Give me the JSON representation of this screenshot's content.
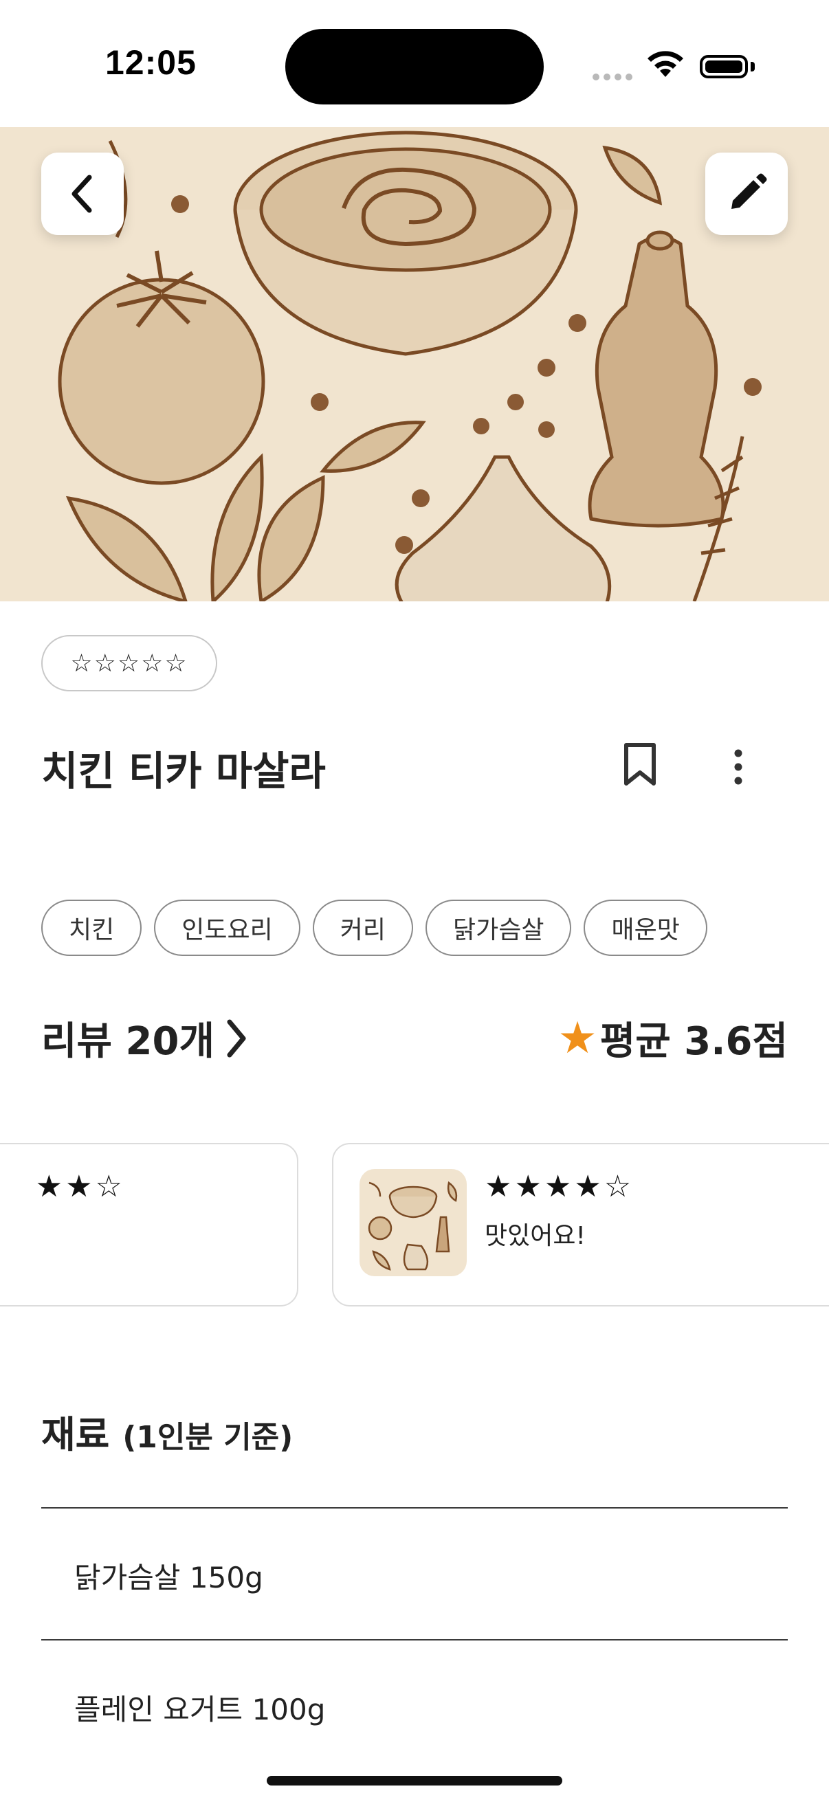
{
  "status_bar": {
    "time": "12:05"
  },
  "recipe": {
    "rating_stars": "☆☆☆☆☆",
    "title": "치킨 티카 마살라",
    "tags": [
      "치킨",
      "인도요리",
      "커리",
      "닭가슴살",
      "매운맛"
    ]
  },
  "reviews": {
    "count_label": "리뷰 20개",
    "average_label": "평균 3.6점",
    "cards": [
      {
        "stars": "★★☆"
      },
      {
        "stars": "★★★★☆",
        "text": "맛있어요!"
      }
    ]
  },
  "ingredients": {
    "title": "재료",
    "subtitle": "(1인분 기준)",
    "items": [
      "닭가슴살 150g",
      "플레인 요거트 100g"
    ]
  },
  "colors": {
    "accent_star": "#f0901a",
    "hero_background": "#f1e4cf"
  }
}
